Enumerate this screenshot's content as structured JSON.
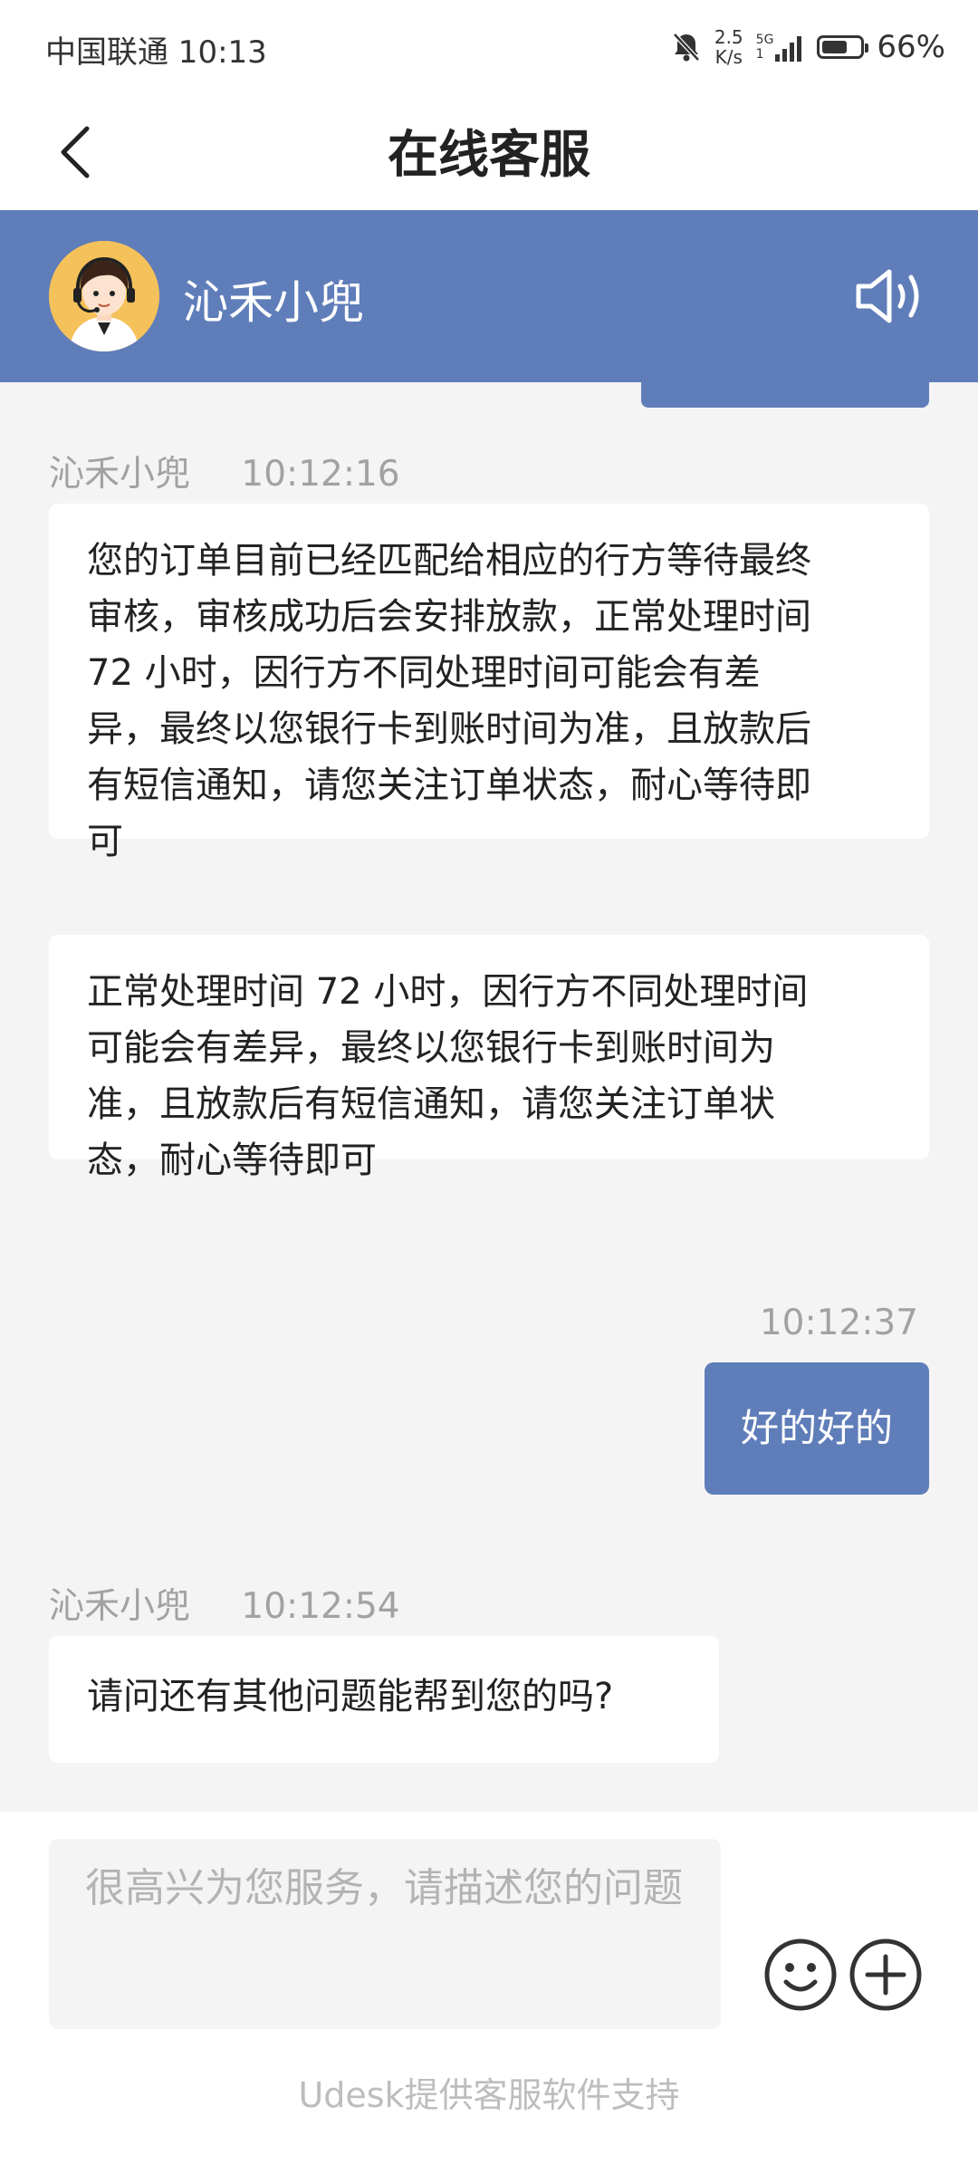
{
  "status_bar": {
    "carrier_time": "中国联通 10:13",
    "net_speed_value": "2.5",
    "net_speed_unit": "K/s",
    "signal_label_top": "5G",
    "signal_label_bottom": "1",
    "battery_percent": "66%",
    "battery_level": 0.66,
    "icons": [
      "bell-muted-icon",
      "signal-icon",
      "battery-icon"
    ]
  },
  "nav": {
    "title": "在线客服",
    "back_icon": "chevron-left-icon"
  },
  "agent": {
    "name": "沁禾小兜",
    "avatar_icon": "headset-agent-avatar",
    "speaker_icon": "speaker-icon"
  },
  "messages": [
    {
      "from": "agent",
      "sender": "沁禾小兜",
      "time": "10:12:16",
      "text": "您的订单目前已经匹配给相应的行方等待最终审核，审核成功后会安排放款，正常处理时间72 小时，因行方不同处理时间可能会有差异，最终以您银行卡到账时间为准，且放款后有短信通知，请您关注订单状态，耐心等待即可",
      "lines": [
        "您的订单目前已经匹配给相应的行方等待最终",
        "审核，审核成功后会安排放款，正常处理时间",
        "72 小时，因行方不同处理时间可能会有差",
        "异，最终以您银行卡到账时间为准，且放款后",
        "有短信通知，请您关注订单状态，耐心等待即",
        "可"
      ]
    },
    {
      "from": "agent",
      "text": "正常处理时间 72 小时，因行方不同处理时间可能会有差异，最终以您银行卡到账时间为准，且放款后有短信通知，请您关注订单状态，耐心等待即可",
      "lines": [
        "正常处理时间 72 小时，因行方不同处理时间",
        "可能会有差异，最终以您银行卡到账时间为",
        "准，且放款后有短信通知，请您关注订单状",
        "态，耐心等待即可"
      ]
    },
    {
      "from": "user",
      "time": "10:12:37",
      "text": "好的好的"
    },
    {
      "from": "agent",
      "sender": "沁禾小兜",
      "time": "10:12:54",
      "text": "请问还有其他问题能帮到您的吗?"
    }
  ],
  "input": {
    "placeholder": "很高兴为您服务，请描述您的问题",
    "emoji_icon": "emoji-icon",
    "plus_icon": "plus-circle-icon"
  },
  "footer": "Udesk提供客服软件支持",
  "colors": {
    "accent": "#5f7db9",
    "background": "#f4f4f4",
    "bubble_in": "#ffffff",
    "meta_text": "#a2a2a2"
  }
}
